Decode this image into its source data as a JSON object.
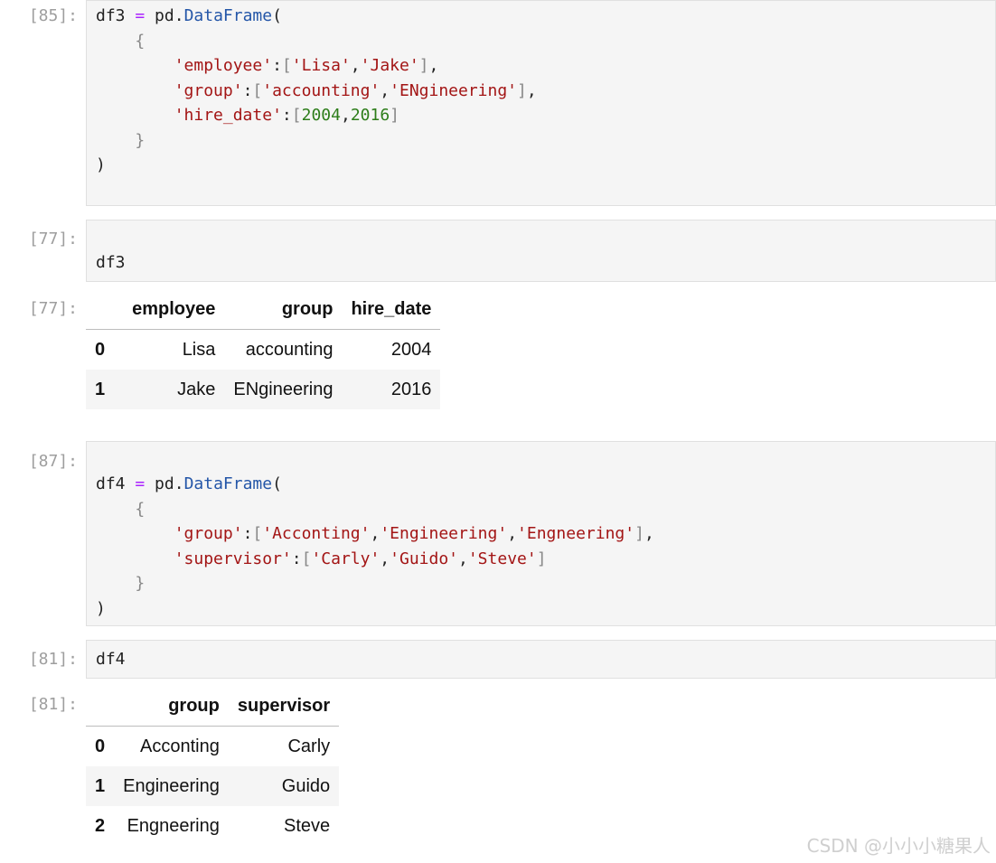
{
  "cells": [
    {
      "prompt": "[85]:"
    },
    {
      "prompt": "[77]:",
      "code": "df3"
    },
    {
      "prompt": "[77]:"
    },
    {
      "prompt": "[87]:"
    },
    {
      "prompt": "[81]:",
      "code": "df4"
    },
    {
      "prompt": "[81]:"
    }
  ],
  "df3_code": {
    "l1_name": "df3",
    "l1_eq": "=",
    "l1_pd": "pd.",
    "l1_cls": "DataFrame",
    "l1_paren": "(",
    "l2": "{",
    "emp_key": "'employee'",
    "emp_colon": ":",
    "emp_ob": "[",
    "emp_v1": "'Lisa'",
    "emp_v2": "'Jake'",
    "emp_cb": "]",
    "emp_comma": ",",
    "grp_key": "'group'",
    "grp_colon": ":",
    "grp_ob": "[",
    "grp_v1": "'accounting'",
    "grp_v2": "'ENgineering'",
    "grp_cb": "]",
    "grp_comma": ",",
    "hd_key": "'hire_date'",
    "hd_colon": ":",
    "hd_ob": "[",
    "hd_v1": "2004",
    "hd_v2": "2016",
    "hd_cb": "]",
    "close_brace": "}",
    "close_paren": ")"
  },
  "df3_table": {
    "columns": [
      "employee",
      "group",
      "hire_date"
    ],
    "rows": [
      {
        "index": "0",
        "employee": "Lisa",
        "group": "accounting",
        "hire_date": "2004"
      },
      {
        "index": "1",
        "employee": "Jake",
        "group": "ENgineering",
        "hire_date": "2016"
      }
    ]
  },
  "df4_code": {
    "l1_name": "df4",
    "l1_eq": "=",
    "l1_pd": "pd.",
    "l1_cls": "DataFrame",
    "l1_paren": "(",
    "l2": "{",
    "grp_key": "'group'",
    "grp_colon": ":",
    "grp_ob": "[",
    "grp_v1": "'Acconting'",
    "grp_v2": "'Engineering'",
    "grp_v3": "'Engneering'",
    "grp_cb": "]",
    "grp_comma": ",",
    "sup_key": "'supervisor'",
    "sup_colon": ":",
    "sup_ob": "[",
    "sup_v1": "'Carly'",
    "sup_v2": "'Guido'",
    "sup_v3": "'Steve'",
    "sup_cb": "]",
    "close_brace": "}",
    "close_paren": ")"
  },
  "df4_table": {
    "columns": [
      "group",
      "supervisor"
    ],
    "rows": [
      {
        "index": "0",
        "group": "Acconting",
        "supervisor": "Carly"
      },
      {
        "index": "1",
        "group": "Engineering",
        "supervisor": "Guido"
      },
      {
        "index": "2",
        "group": "Engneering",
        "supervisor": "Steve"
      }
    ]
  },
  "watermark": "CSDN @小小小糖果人"
}
